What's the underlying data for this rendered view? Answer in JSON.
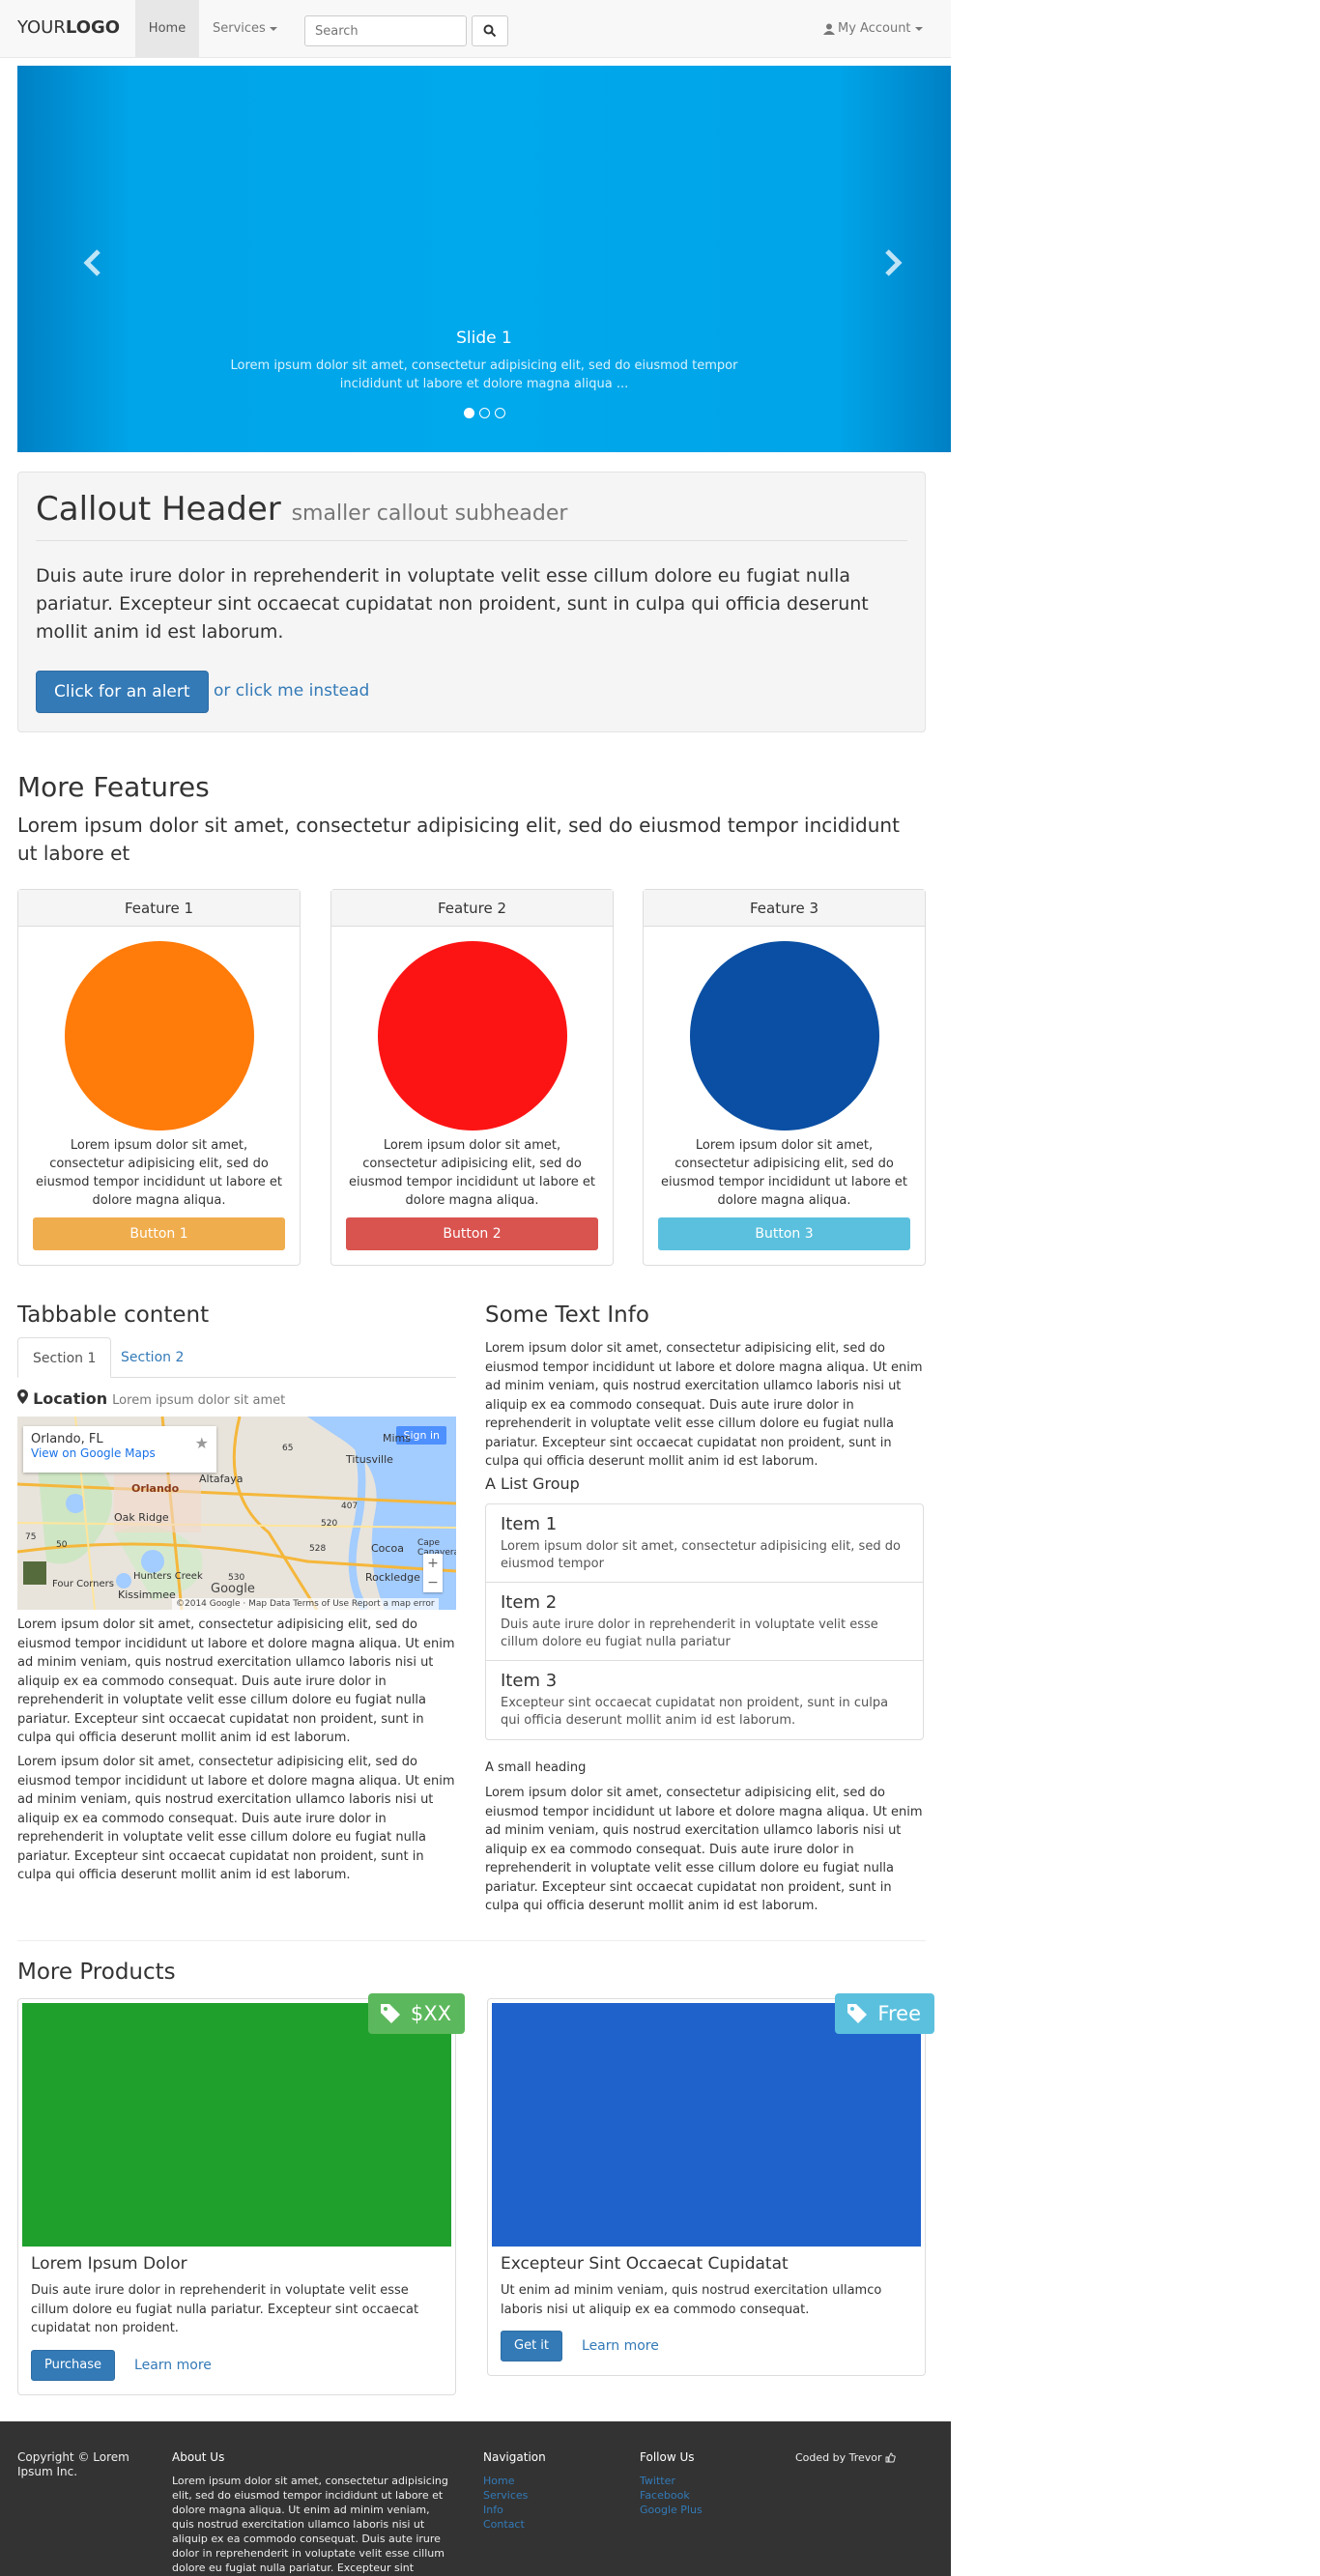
{
  "navbar": {
    "brand_left": "YOUR",
    "brand_right": "LOGO",
    "home": "Home",
    "services": "Services",
    "search_placeholder": "Search",
    "account": "My Account"
  },
  "carousel": {
    "title": "Slide 1",
    "text": "Lorem ipsum dolor sit amet, consectetur adipisicing elit, sed do eiusmod tempor incididunt ut labore et dolore magna aliqua ...",
    "active_index": 0
  },
  "callout": {
    "header": "Callout Header",
    "subheader": "smaller callout subheader",
    "text": "Duis aute irure dolor in reprehenderit in voluptate velit esse cillum dolore eu fugiat nulla pariatur. Excepteur sint occaecat cupidatat non proident, sunt in culpa qui officia deserunt mollit anim id est laborum.",
    "button": "Click for an alert",
    "link": "or click me instead"
  },
  "features": {
    "heading": "More Features",
    "lead": "Lorem ipsum dolor sit amet, consectetur adipisicing elit, sed do eiusmod tempor incididunt ut labore et",
    "items": [
      {
        "title": "Feature 1",
        "text": "Lorem ipsum dolor sit amet, consectetur adipisicing elit, sed do eiusmod tempor incididunt ut labore et dolore magna aliqua.",
        "button": "Button 1",
        "circle_color": "#ff7b0a",
        "button_color": "#f0ad4e"
      },
      {
        "title": "Feature 2",
        "text": "Lorem ipsum dolor sit amet, consectetur adipisicing elit, sed do eiusmod tempor incididunt ut labore et dolore magna aliqua.",
        "button": "Button 2",
        "circle_color": "#fc1414",
        "button_color": "#d9534f"
      },
      {
        "title": "Feature 3",
        "text": "Lorem ipsum dolor sit amet, consectetur adipisicing elit, sed do eiusmod tempor incididunt ut labore et dolore magna aliqua.",
        "button": "Button 3",
        "circle_color": "#0a4fa3",
        "button_color": "#5bc0de"
      }
    ]
  },
  "tabbable": {
    "heading": "Tabbable content",
    "tabs": [
      "Section 1",
      "Section 2"
    ],
    "location_label": "Location",
    "location_text": "Lorem ipsum dolor sit amet",
    "map": {
      "place": "Orlando, FL",
      "view_link": "View on Google Maps",
      "sign_in": "Sign in",
      "labels": [
        "Titusville",
        "Orlando",
        "Altafaya",
        "Oak Ridge",
        "Kissimmee",
        "Cocoa",
        "Rockledge",
        "Cape Canaveral",
        "Mims",
        "Hunters Creek",
        "Four Corners"
      ],
      "road_numbers": [
        "407",
        "528",
        "520",
        "530",
        "50",
        "65",
        "75"
      ],
      "logo": "Google",
      "footer": "©2014 Google · Map Data   Terms of Use   Report a map error"
    },
    "para1": "Lorem ipsum dolor sit amet, consectetur adipisicing elit, sed do eiusmod tempor incididunt ut labore et dolore magna aliqua. Ut enim ad minim veniam, quis nostrud exercitation ullamco laboris nisi ut aliquip ex ea commodo consequat. Duis aute irure dolor in reprehenderit in voluptate velit esse cillum dolore eu fugiat nulla pariatur. Excepteur sint occaecat cupidatat non proident, sunt in culpa qui officia deserunt mollit anim id est laborum.",
    "para2": "Lorem ipsum dolor sit amet, consectetur adipisicing elit, sed do eiusmod tempor incididunt ut labore et dolore magna aliqua. Ut enim ad minim veniam, quis nostrud exercitation ullamco laboris nisi ut aliquip ex ea commodo consequat. Duis aute irure dolor in reprehenderit in voluptate velit esse cillum dolore eu fugiat nulla pariatur. Excepteur sint occaecat cupidatat non proident, sunt in culpa qui officia deserunt mollit anim id est laborum."
  },
  "textinfo": {
    "heading": "Some Text Info",
    "para": "Lorem ipsum dolor sit amet, consectetur adipisicing elit, sed do eiusmod tempor incididunt ut labore et dolore magna aliqua. Ut enim ad minim veniam, quis nostrud exercitation ullamco laboris nisi ut aliquip ex ea commodo consequat. Duis aute irure dolor in reprehenderit in voluptate velit esse cillum dolore eu fugiat nulla pariatur. Excepteur sint occaecat cupidatat non proident, sunt in culpa qui officia deserunt mollit anim id est laborum.",
    "list_heading": "A List Group",
    "items": [
      {
        "title": "Item 1",
        "text": "Lorem ipsum dolor sit amet, consectetur adipisicing elit, sed do eiusmod tempor"
      },
      {
        "title": "Item 2",
        "text": "Duis aute irure dolor in reprehenderit in voluptate velit esse cillum dolore eu fugiat nulla pariatur"
      },
      {
        "title": "Item 3",
        "text": "Excepteur sint occaecat cupidatat non proident, sunt in culpa qui officia deserunt mollit anim id est laborum."
      }
    ],
    "small_heading": "A small heading",
    "para2": "Lorem ipsum dolor sit amet, consectetur adipisicing elit, sed do eiusmod tempor incididunt ut labore et dolore magna aliqua. Ut enim ad minim veniam, quis nostrud exercitation ullamco laboris nisi ut aliquip ex ea commodo consequat. Duis aute irure dolor in reprehenderit in voluptate velit esse cillum dolore eu fugiat nulla pariatur. Excepteur sint occaecat cupidatat non proident, sunt in culpa qui officia deserunt mollit anim id est laborum."
  },
  "products": {
    "heading": "More Products",
    "items": [
      {
        "price": "$XX",
        "title": "Lorem Ipsum Dolor",
        "text": "Duis aute irure dolor in reprehenderit in voluptate velit esse cillum dolore eu fugiat nulla pariatur. Excepteur sint occaecat cupidatat non proident.",
        "button": "Purchase",
        "link": "Learn more",
        "image_color": "#1fa02c",
        "price_color": "#5cb85c"
      },
      {
        "price": "Free",
        "title": "Excepteur Sint Occaecat Cupidatat",
        "text": "Ut enim ad minim veniam, quis nostrud exercitation ullamco laboris nisi ut aliquip ex ea commodo consequat.",
        "button": "Get it",
        "link": "Learn more",
        "image_color": "#2062cc",
        "price_color": "#5bc0de"
      }
    ]
  },
  "footer": {
    "copyright": "Copyright © Lorem Ipsum Inc.",
    "about_heading": "About Us",
    "about_text": "Lorem ipsum dolor sit amet, consectetur adipisicing elit, sed do eiusmod tempor incididunt ut labore et dolore magna aliqua. Ut enim ad minim veniam, quis nostrud exercitation ullamco laboris nisi ut aliquip ex ea commodo consequat. Duis aute irure dolor in reprehenderit in voluptate velit esse cillum dolore eu fugiat nulla pariatur. Excepteur sint occaecat cupidatat non proident, sunt in culpa qui officia deserunt",
    "nav_heading": "Navigation",
    "nav_links": [
      "Home",
      "Services",
      "Info",
      "Contact"
    ],
    "follow_heading": "Follow Us",
    "follow_links": [
      "Twitter",
      "Facebook",
      "Google Plus"
    ],
    "coded_by": "Coded by Trevor"
  }
}
